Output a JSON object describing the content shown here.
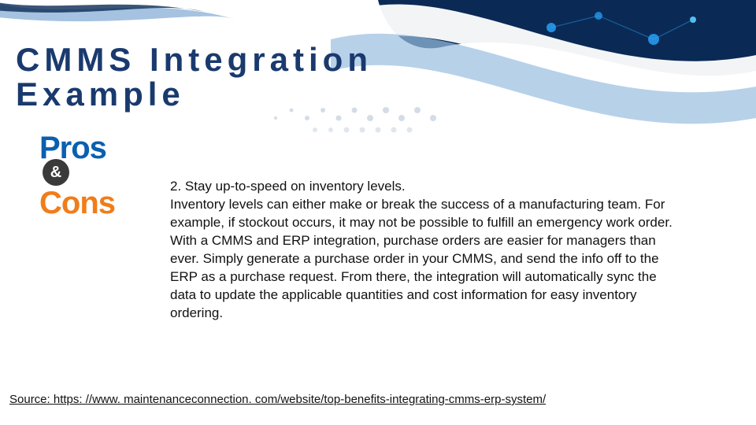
{
  "title_line1": "CMMS Integration",
  "title_line2": "Example",
  "pros_cons": {
    "pros": "Pros",
    "amp": "&",
    "cons": "Cons"
  },
  "body": {
    "heading": "2. Stay up-to-speed on inventory levels.",
    "p1": "Inventory levels can either make or break the success of a manufacturing team. For example, if stockout occurs, it may not be possible to fulfill an emergency work order.",
    "p2": "With a CMMS and ERP integration, purchase orders are easier for managers than ever. Simply generate a purchase order in your CMMS, and send the info off to the ERP as a purchase request. From there, the integration will automatically sync the data to update the applicable quantities and cost information for easy inventory ordering."
  },
  "source": {
    "label": "Source: ",
    "url": "https: //www. maintenanceconnection. com/website/top-benefits-integrating-cmms-erp-system/"
  }
}
